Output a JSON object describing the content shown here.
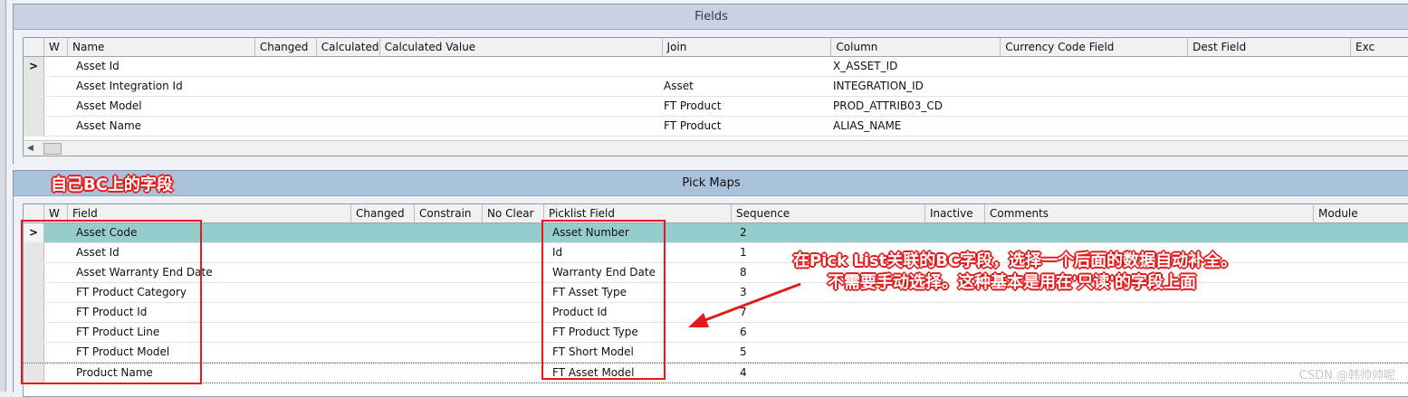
{
  "fields_panel": {
    "title": "Fields",
    "columns": [
      "W",
      "Name",
      "Changed",
      "Calculated",
      "Calculated Value",
      "Join",
      "Column",
      "Currency Code Field",
      "Dest Field",
      "Exc"
    ],
    "rows": [
      {
        "selector": ">",
        "name": "Asset Id",
        "join": "",
        "column": "X_ASSET_ID"
      },
      {
        "selector": "",
        "name": "Asset Integration Id",
        "join": "Asset",
        "column": "INTEGRATION_ID"
      },
      {
        "selector": "",
        "name": "Asset Model",
        "join": "FT Product",
        "column": "PROD_ATTRIB03_CD"
      },
      {
        "selector": "",
        "name": "Asset Name",
        "join": "FT Product",
        "column": "ALIAS_NAME"
      }
    ],
    "scroll_left_arrow": "◀"
  },
  "pick_maps_panel": {
    "title": "Pick Maps",
    "columns": [
      "W",
      "Field",
      "Changed",
      "Constrain",
      "No Clear",
      "Picklist Field",
      "Sequence",
      "Inactive",
      "Comments",
      "Module"
    ],
    "rows": [
      {
        "selector": ">",
        "field": "Asset Code",
        "picklist_field": "Asset Number",
        "sequence": "2"
      },
      {
        "selector": "",
        "field": "Asset Id",
        "picklist_field": "Id",
        "sequence": "1"
      },
      {
        "selector": "",
        "field": "Asset Warranty End Date",
        "picklist_field": "Warranty End Date",
        "sequence": "8"
      },
      {
        "selector": "",
        "field": "FT Product Category",
        "picklist_field": "FT Asset Type",
        "sequence": "3"
      },
      {
        "selector": "",
        "field": "FT Product Id",
        "picklist_field": "Product Id",
        "sequence": "7"
      },
      {
        "selector": "",
        "field": "FT Product Line",
        "picklist_field": "FT Product Type",
        "sequence": "6"
      },
      {
        "selector": "",
        "field": "FT Product Model",
        "picklist_field": "FT Short Model",
        "sequence": "5"
      },
      {
        "selector": "",
        "field": "Product Name",
        "picklist_field": "FT Asset Model",
        "sequence": "4"
      }
    ]
  },
  "annotations": {
    "own_bc_fields": "自己BC上的字段",
    "note_line1": "在Pick List关联的BC字段，选择一个后面的数据自动补全。",
    "note_line2": "不需要手动选择。这种基本是用在'只读'的字段上面",
    "color": "#e31b1b"
  },
  "watermark": "CSDN @韩帅帅呢"
}
